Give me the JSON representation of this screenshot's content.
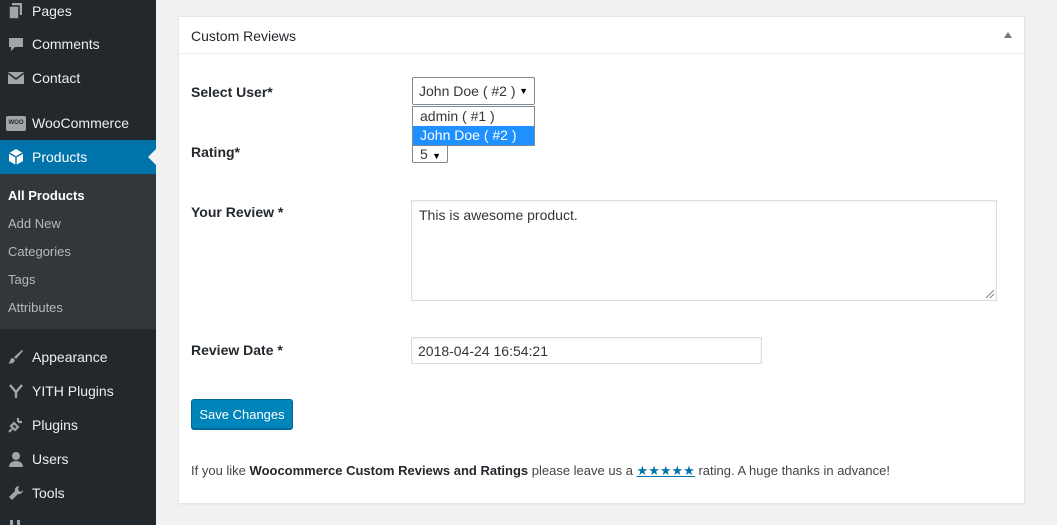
{
  "sidebar": {
    "items": [
      {
        "id": "pages",
        "label": "Pages",
        "icon": "pages-icon"
      },
      {
        "id": "comments",
        "label": "Comments",
        "icon": "comments-icon"
      },
      {
        "id": "contact",
        "label": "Contact",
        "icon": "mail-icon"
      },
      {
        "id": "woocommerce",
        "label": "WooCommerce",
        "icon": "woo-icon",
        "icon_text": "WOO"
      },
      {
        "id": "products",
        "label": "Products",
        "icon": "box-icon"
      },
      {
        "id": "appearance",
        "label": "Appearance",
        "icon": "brush-icon"
      },
      {
        "id": "yith",
        "label": "YITH Plugins",
        "icon": "yith-icon"
      },
      {
        "id": "plugins",
        "label": "Plugins",
        "icon": "plug-icon"
      },
      {
        "id": "users",
        "label": "Users",
        "icon": "user-icon"
      },
      {
        "id": "tools",
        "label": "Tools",
        "icon": "wrench-icon"
      }
    ],
    "submenu": [
      {
        "label": "All Products"
      },
      {
        "label": "Add New"
      },
      {
        "label": "Categories"
      },
      {
        "label": "Tags"
      },
      {
        "label": "Attributes"
      }
    ],
    "colors": {
      "background": "#23282d",
      "active": "#0073aa",
      "submenu": "#32373c"
    }
  },
  "panel": {
    "title": "Custom Reviews",
    "select_user": {
      "label": "Select User*",
      "value": "John Doe ( #2 )",
      "options": [
        "admin ( #1 )",
        "John Doe ( #2 )"
      ]
    },
    "rating": {
      "label": "Rating*",
      "value": "5"
    },
    "review": {
      "label": "Your Review *",
      "value": "This is awesome product."
    },
    "review_date": {
      "label": "Review Date *",
      "value": "2018-04-24 16:54:21"
    },
    "save_label": "Save Changes",
    "footer": {
      "prefix": "If you like ",
      "plugin_name": "Woocommerce Custom Reviews and Ratings",
      "middle": " please leave us a ",
      "stars": "★★★★★",
      "suffix": " rating. A huge thanks in advance!"
    },
    "colors": {
      "button": "#0085ba",
      "link": "#0073aa",
      "dropdown_highlight": "#1e90ff"
    }
  }
}
